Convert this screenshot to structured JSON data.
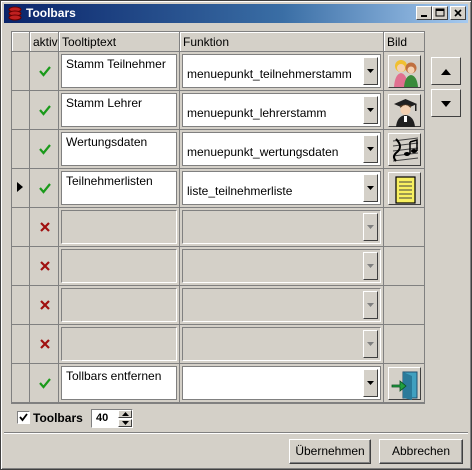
{
  "window": {
    "title": "Toolbars"
  },
  "columns": {
    "aktiv": "aktiv",
    "tooltip": "Tooltiptext",
    "funktion": "Funktion",
    "bild": "Bild"
  },
  "rows": [
    {
      "active": true,
      "tooltip": "Stamm Teilnehmer",
      "funktion": "menuepunkt_teilnehmerstamm",
      "icon": "students-icon",
      "current": false
    },
    {
      "active": true,
      "tooltip": "Stamm Lehrer",
      "funktion": "menuepunkt_lehrerstamm",
      "icon": "teacher-icon",
      "current": false
    },
    {
      "active": true,
      "tooltip": "Wertungsdaten",
      "funktion": "menuepunkt_wertungsdaten",
      "icon": "music-notes-icon",
      "current": false
    },
    {
      "active": true,
      "tooltip": "Teilnehmerlisten",
      "funktion": "liste_teilnehmerliste",
      "icon": "notepad-icon",
      "current": true
    },
    {
      "active": false,
      "tooltip": "",
      "funktion": "",
      "icon": "",
      "current": false
    },
    {
      "active": false,
      "tooltip": "",
      "funktion": "",
      "icon": "",
      "current": false
    },
    {
      "active": false,
      "tooltip": "",
      "funktion": "",
      "icon": "",
      "current": false
    },
    {
      "active": false,
      "tooltip": "",
      "funktion": "",
      "icon": "",
      "current": false
    },
    {
      "active": true,
      "tooltip": "Tollbars entfernen",
      "funktion": "",
      "icon": "exit-door-icon",
      "current": false
    }
  ],
  "toolbars_checkbox": {
    "label": "Toolbars",
    "checked": true
  },
  "size_spinner": {
    "value": "40"
  },
  "buttons": {
    "apply": "Übernehmen",
    "cancel": "Abbrechen"
  },
  "colors": {
    "title_bar": "#0a246a",
    "check_green": "#1a9a1a",
    "cross_red": "#a01010",
    "dialog_grey": "#d4d0c8"
  }
}
